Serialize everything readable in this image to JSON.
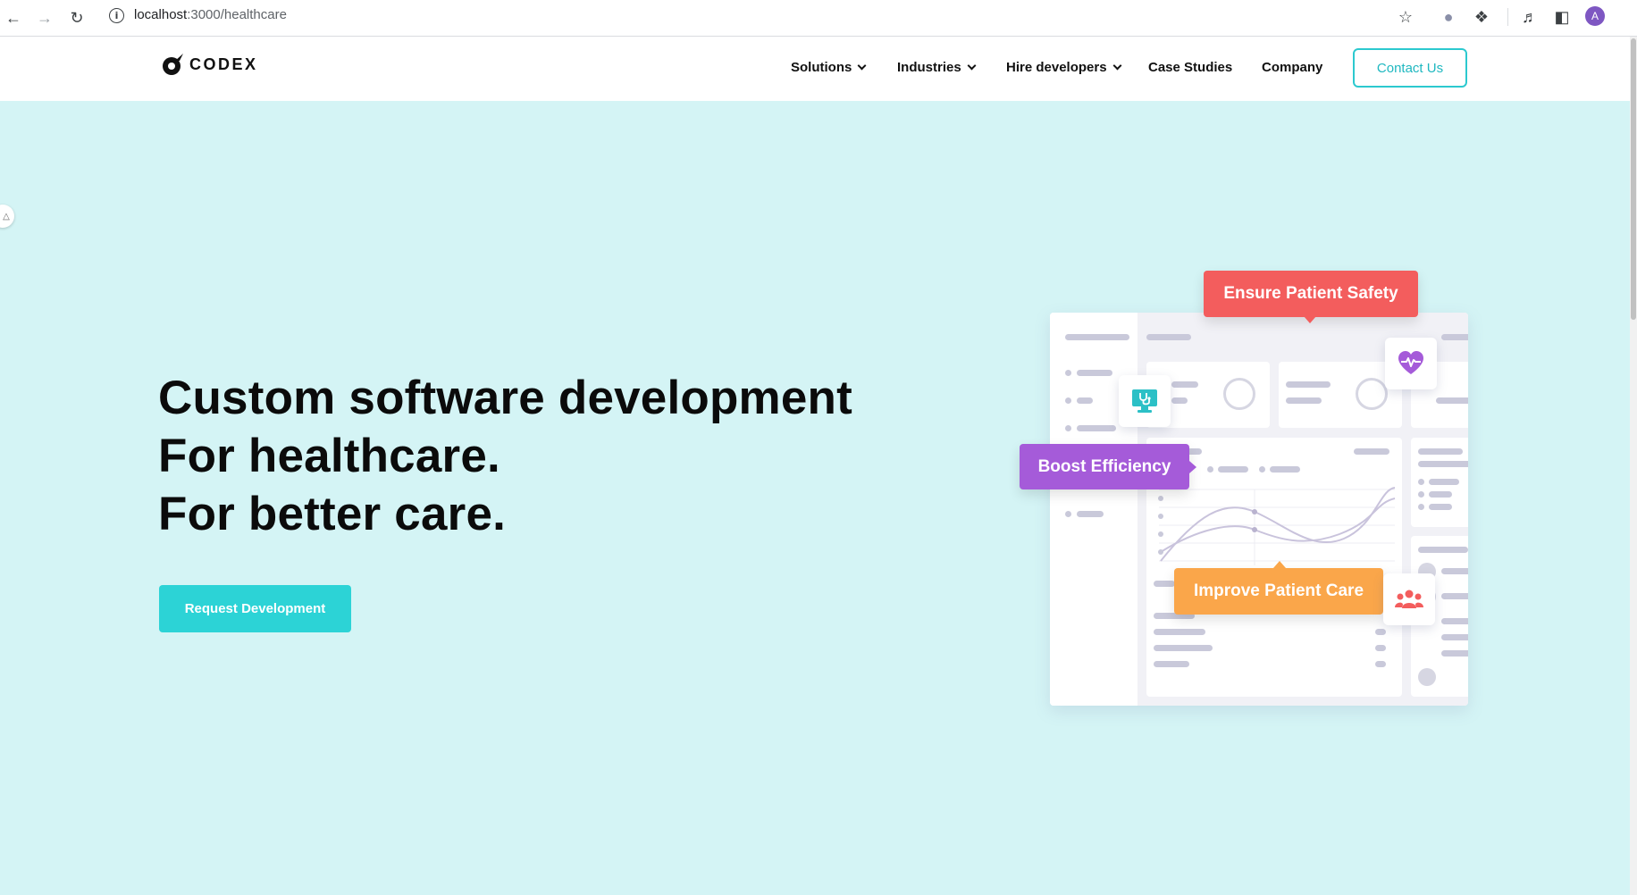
{
  "browser": {
    "url_host": "localhost",
    "url_path": ":3000/healthcare",
    "profile_initial": "A",
    "icons": [
      "back-icon",
      "forward-icon",
      "reload-icon",
      "info-icon",
      "star-icon",
      "extension-icon",
      "puzzle-icon",
      "media-icon",
      "sidepanel-icon"
    ]
  },
  "header": {
    "logo_text": "CODEX",
    "nav": [
      {
        "label": "Solutions",
        "dropdown": true
      },
      {
        "label": "Industries",
        "dropdown": true
      },
      {
        "label": "Hire developers",
        "dropdown": true
      },
      {
        "label": "Case Studies",
        "dropdown": false
      },
      {
        "label": "Company",
        "dropdown": false
      }
    ],
    "contact_label": "Contact Us"
  },
  "hero": {
    "title_lines": [
      "Custom software development",
      "For healthcare.",
      "For better care."
    ],
    "cta_label": "Request Development"
  },
  "illustration": {
    "tags": {
      "safety": "Ensure Patient Safety",
      "efficiency": "Boost Efficiency",
      "care": "Improve Patient Care"
    },
    "icons": [
      "heartbeat-icon",
      "doctor-monitor-icon",
      "people-group-icon"
    ]
  },
  "colors": {
    "accent": "#2cd3d6",
    "hero_bg": "#d4f4f5",
    "tag_red": "#f35d5d",
    "tag_purple": "#a55bd9",
    "tag_orange": "#faa64a"
  }
}
